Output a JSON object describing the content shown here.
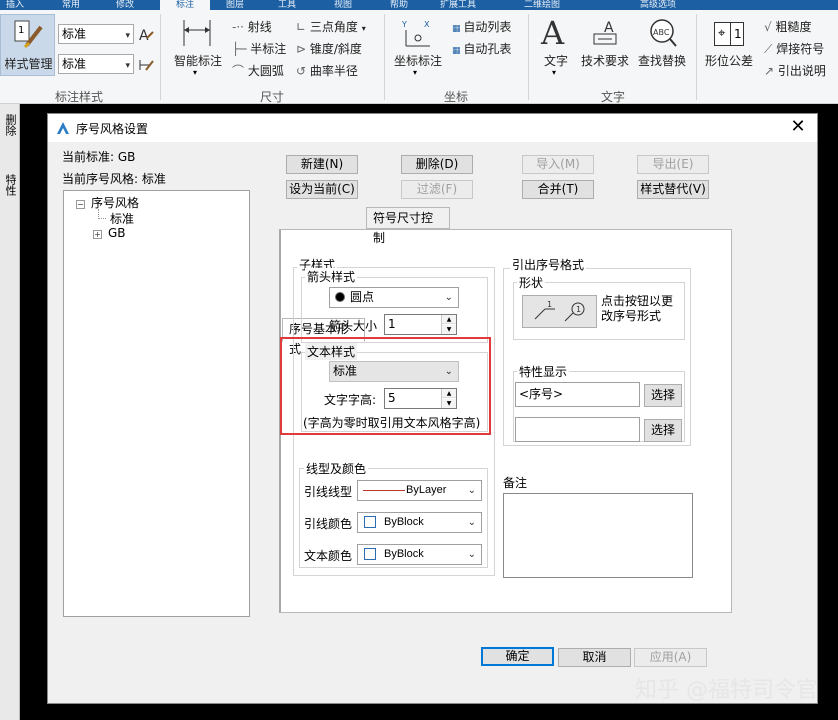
{
  "ribbon": {
    "tabs": [
      "插入",
      "常用",
      "修改",
      "标注",
      "图层",
      "工具",
      "视图",
      "帮助",
      "扩展工具",
      "二维绘图",
      "高级选项"
    ],
    "active_tab_index": 3,
    "style_group": {
      "manage_label": "样式管理",
      "combo1": "标准",
      "combo2": "标准",
      "group_label": "标注样式"
    },
    "dim_group": {
      "smart_label": "智能标注",
      "items": [
        "射线",
        "半标注",
        "大圆弧",
        "三点角度",
        "锥度/斜度",
        "曲率半径"
      ],
      "group_label": "尺寸"
    },
    "coord_group": {
      "coord_label": "坐标标注",
      "items": [
        "自动列表",
        "自动孔表"
      ],
      "group_label": "坐标"
    },
    "text_group": {
      "items": [
        "文字",
        "技术要求",
        "查找替换"
      ],
      "abc_glyph": "ABC",
      "group_label": "文字"
    },
    "misc_group": {
      "tolerance_label": "形位公差",
      "tolerance_glyph": "1",
      "items": [
        "粗糙度",
        "焊接符号",
        "引出说明"
      ]
    }
  },
  "leftstrip": {
    "items": [
      "删除",
      "特性"
    ]
  },
  "dialog": {
    "title": "序号风格设置",
    "close_glyph": "✕",
    "current_standard_label": "当前标准:",
    "current_standard_value": "GB",
    "current_style_label": "当前序号风格:",
    "current_style_value": "标准",
    "tree": {
      "root": "序号风格",
      "child": "标准",
      "gb": "GB",
      "collapse_glyph": "−",
      "expand_glyph": "+"
    },
    "buttons": {
      "new": "新建(N)",
      "delete": "删除(D)",
      "import": "导入(M)",
      "export": "导出(E)",
      "set_current": "设为当前(C)",
      "filter": "过滤(F)",
      "merge": "合并(T)",
      "style_replace": "样式替代(V)"
    },
    "tabs": [
      "序号基本形式",
      "符号尺寸控制"
    ],
    "sub_style": {
      "title": "子样式",
      "arrow_style_title": "箭头样式",
      "arrow_style_value": "圆点",
      "arrow_size_label": "箭头大小",
      "arrow_size_value": "1",
      "text_style_title": "文本样式",
      "text_style_value": "标准",
      "text_height_label": "文字字高:",
      "text_height_value": "5",
      "note": "(字高为零时取引用文本风格字高)"
    },
    "line_color": {
      "title": "线型及颜色",
      "leader_linetype_label": "引线线型",
      "leader_linetype_value": "ByLayer",
      "leader_color_label": "引线颜色",
      "leader_color_value": "ByBlock",
      "text_color_label": "文本颜色",
      "text_color_value": "ByBlock",
      "linetype_color": "#c0392b"
    },
    "leader_format": {
      "title": "引出序号格式",
      "shape_title": "形状",
      "shape_hint": "点击按钮以更改序号形式",
      "shape_digit": "1",
      "property_title": "特性显示",
      "property_value1": "<序号>",
      "property_value2": "",
      "select_label": "选择"
    },
    "remark_title": "备注",
    "remark_value": "",
    "footer": {
      "ok": "确定",
      "cancel": "取消",
      "apply": "应用(A)"
    }
  },
  "watermark": "知乎 @福特司令官",
  "colors": {
    "highlight_box": "#e03a3a",
    "ribbon_blue": "#1c5fa3",
    "default_button_border": "#0078d7"
  }
}
